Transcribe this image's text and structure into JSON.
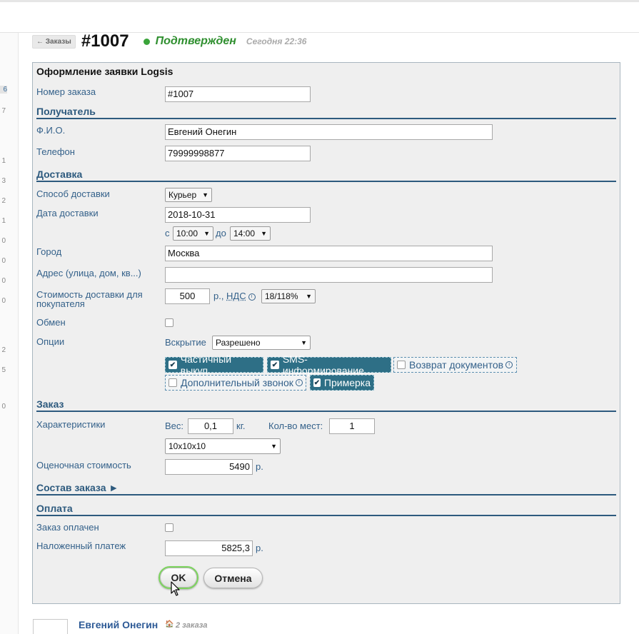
{
  "header": {
    "back_label": "← Заказы",
    "order_number": "#1007",
    "status": "Подтвержден",
    "status_time": "Сегодня 22:36",
    "status_color": "#3aa43a"
  },
  "left_numbers": [
    "6",
    "7",
    "1",
    "3",
    "2",
    "1",
    "0",
    "0",
    "0",
    "0",
    "2",
    "5",
    "0"
  ],
  "form": {
    "title": "Оформление заявки Logsis",
    "order_number_label": "Номер заказа",
    "order_number_value": "#1007",
    "sections": {
      "recipient": "Получатель",
      "delivery": "Доставка",
      "order": "Заказ",
      "composition": "Состав заказа ►",
      "payment": "Оплата"
    },
    "fio_label": "Ф.И.О.",
    "fio_value": "Евгений Онегин",
    "phone_label": "Телефон",
    "phone_value": "79999998877",
    "delivery_method_label": "Способ доставки",
    "delivery_method_value": "Курьер",
    "delivery_date_label": "Дата доставки",
    "delivery_date_value": "2018-10-31",
    "time_from_prefix": "с",
    "time_from_value": "10:00",
    "time_to_prefix": "до",
    "time_to_value": "14:00",
    "city_label": "Город",
    "city_value": "Москва",
    "address_label": "Адрес (улица, дом, кв...)",
    "address_value": "",
    "delivery_cost_label": "Стоимость доставки для покупателя",
    "delivery_cost_value": "500",
    "currency": "р.,",
    "vat_label": "НДС",
    "vat_value": "18/118%",
    "exchange_label": "Обмен",
    "options_label": "Опции",
    "opening_label": "Вскрытие",
    "opening_value": "Разрешено",
    "options": [
      {
        "label": "Частичный выкуп",
        "checked": true
      },
      {
        "label": "SMS-информирование",
        "checked": true
      },
      {
        "label": "Возврат документов",
        "checked": false
      },
      {
        "label": "Дополнительный звонок",
        "checked": false
      },
      {
        "label": "Примерка",
        "checked": true
      }
    ],
    "characteristics_label": "Характеристики",
    "weight_label": "Вес:",
    "weight_value": "0,1",
    "weight_unit": "кг.",
    "places_label": "Кол-во мест:",
    "places_value": "1",
    "dimensions_value": "10x10x10",
    "estimated_cost_label": "Оценочная стоимость",
    "estimated_cost_value": "5490",
    "currency_short": "р.",
    "paid_label": "Заказ оплачен",
    "cod_label": "Наложенный платеж",
    "cod_value": "5825,3",
    "ok_label": "OK",
    "cancel_label": "Отмена"
  },
  "footer": {
    "customer_name": "Евгений Онегин",
    "orders_count": "2 заказа"
  }
}
